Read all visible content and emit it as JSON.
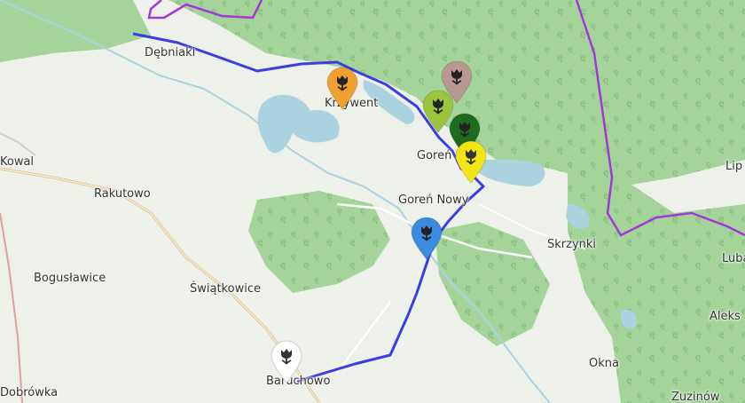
{
  "map": {
    "colors": {
      "land": "#eef0ea",
      "forest": "#a5d49b",
      "water": "#aad3df",
      "route": "#3b3fe0",
      "border": "#a437d8",
      "road": "#d9c08a"
    },
    "places": [
      {
        "id": "debniaki",
        "name": "Dębniaki"
      },
      {
        "id": "krzywent",
        "name": "Krzywent"
      },
      {
        "id": "goren-stary",
        "name": "Goreń Stary"
      },
      {
        "id": "goren-nowy",
        "name": "Goreń Nowy"
      },
      {
        "id": "rakutowo",
        "name": "Rakutowo"
      },
      {
        "id": "boguslawice",
        "name": "Bogusławice"
      },
      {
        "id": "swiatkowice",
        "name": "Świątkowice"
      },
      {
        "id": "skrzynki",
        "name": "Skrzynki"
      },
      {
        "id": "okna",
        "name": "Okna"
      },
      {
        "id": "zuzinow",
        "name": "Zuzinów"
      },
      {
        "id": "baruchowo",
        "name": "Baruchowo"
      },
      {
        "id": "kowal",
        "name": "Kowal"
      },
      {
        "id": "dobrowka",
        "name": "Dobrówka"
      },
      {
        "id": "lipiny",
        "name": "Lip"
      },
      {
        "id": "lubanie",
        "name": "Luba"
      },
      {
        "id": "aleksandrowo",
        "name": "Aleks"
      }
    ],
    "markers": [
      {
        "id": "orange",
        "color": "#f0a030",
        "icon": "tulip-icon"
      },
      {
        "id": "brown",
        "color": "#b89892",
        "icon": "tulip-icon"
      },
      {
        "id": "lime",
        "color": "#9cc43c",
        "icon": "tulip-icon"
      },
      {
        "id": "darkgreen",
        "color": "#1f6b1f",
        "icon": "tulip-icon"
      },
      {
        "id": "yellow",
        "color": "#f3e414",
        "icon": "tulip-icon"
      },
      {
        "id": "blue",
        "color": "#3b8be0",
        "icon": "tulip-icon"
      },
      {
        "id": "white",
        "color": "#ffffff",
        "icon": "tulip-icon"
      }
    ]
  }
}
